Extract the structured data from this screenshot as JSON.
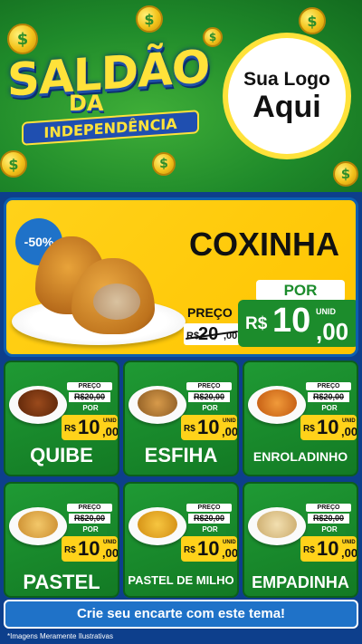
{
  "hero": {
    "title_line1": "SALDÃO",
    "title_line2": "DA",
    "title_line3": "INDEPENDÊNCIA",
    "coin_symbol": "$",
    "logo_line1": "Sua Logo",
    "logo_line2": "Aqui"
  },
  "featured": {
    "discount": "-50%",
    "name": "COXINHA",
    "preco_label": "PREÇO",
    "old_currency": "R$",
    "old_whole": "20",
    "old_cents": ",00",
    "por_label": "POR",
    "currency": "R$",
    "price_whole": "10",
    "unid": "UNID",
    "price_cents": ",00"
  },
  "products": [
    {
      "name": "QUIBE",
      "preco": "PREÇO",
      "old": "R$20,00",
      "por": "POR",
      "currency": "R$",
      "whole": "10",
      "unid": "UNID",
      "cents": ",00",
      "food_color": "#7a3a14"
    },
    {
      "name": "ESFIHA",
      "preco": "PREÇO",
      "old": "R$20,00",
      "por": "POR",
      "currency": "R$",
      "whole": "10",
      "unid": "UNID",
      "cents": ",00",
      "food_color": "#c98b3b"
    },
    {
      "name": "ENROLADINHO",
      "preco": "PREÇO",
      "old": "R$20,00",
      "por": "POR",
      "currency": "R$",
      "whole": "10",
      "unid": "UNID",
      "cents": ",00",
      "food_color": "#e07b1c"
    },
    {
      "name": "PASTEL",
      "preco": "PREÇO",
      "old": "R$20,00",
      "por": "POR",
      "currency": "R$",
      "whole": "10",
      "unid": "UNID",
      "cents": ",00",
      "food_color": "#e8b04a"
    },
    {
      "name": "PASTEL DE MILHO",
      "preco": "PREÇO",
      "old": "R$20,00",
      "por": "POR",
      "currency": "R$",
      "whole": "10",
      "unid": "UNID",
      "cents": ",00",
      "food_color": "#f0b52a"
    },
    {
      "name": "EMPADINHA",
      "preco": "PREÇO",
      "old": "R$20,00",
      "por": "POR",
      "currency": "R$",
      "whole": "10",
      "unid": "UNID",
      "cents": ",00",
      "food_color": "#e6cf9a"
    }
  ],
  "cta": {
    "label": "Crie seu encarte com este tema!"
  },
  "footnote": "*Imagens Meramente Ilustrativas",
  "colors": {
    "brand_green": "#1c8c2c",
    "brand_yellow": "#ffd21a",
    "brand_blue": "#1f72c8"
  }
}
